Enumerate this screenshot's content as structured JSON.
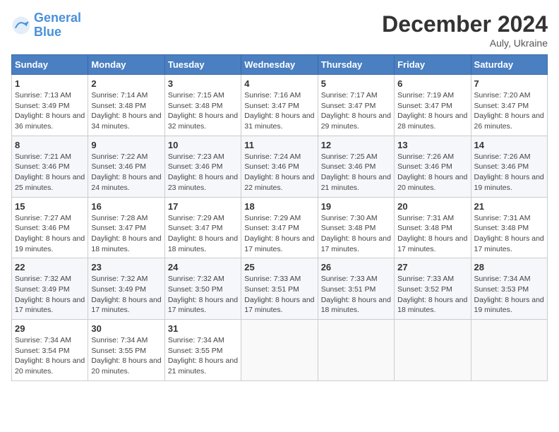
{
  "header": {
    "logo_general": "General",
    "logo_blue": "Blue",
    "month_year": "December 2024",
    "location": "Auly, Ukraine"
  },
  "days_of_week": [
    "Sunday",
    "Monday",
    "Tuesday",
    "Wednesday",
    "Thursday",
    "Friday",
    "Saturday"
  ],
  "weeks": [
    [
      {
        "day": "1",
        "sunrise": "7:13 AM",
        "sunset": "3:49 PM",
        "daylight": "8 hours and 36 minutes."
      },
      {
        "day": "2",
        "sunrise": "7:14 AM",
        "sunset": "3:48 PM",
        "daylight": "8 hours and 34 minutes."
      },
      {
        "day": "3",
        "sunrise": "7:15 AM",
        "sunset": "3:48 PM",
        "daylight": "8 hours and 32 minutes."
      },
      {
        "day": "4",
        "sunrise": "7:16 AM",
        "sunset": "3:47 PM",
        "daylight": "8 hours and 31 minutes."
      },
      {
        "day": "5",
        "sunrise": "7:17 AM",
        "sunset": "3:47 PM",
        "daylight": "8 hours and 29 minutes."
      },
      {
        "day": "6",
        "sunrise": "7:19 AM",
        "sunset": "3:47 PM",
        "daylight": "8 hours and 28 minutes."
      },
      {
        "day": "7",
        "sunrise": "7:20 AM",
        "sunset": "3:47 PM",
        "daylight": "8 hours and 26 minutes."
      }
    ],
    [
      {
        "day": "8",
        "sunrise": "7:21 AM",
        "sunset": "3:46 PM",
        "daylight": "8 hours and 25 minutes."
      },
      {
        "day": "9",
        "sunrise": "7:22 AM",
        "sunset": "3:46 PM",
        "daylight": "8 hours and 24 minutes."
      },
      {
        "day": "10",
        "sunrise": "7:23 AM",
        "sunset": "3:46 PM",
        "daylight": "8 hours and 23 minutes."
      },
      {
        "day": "11",
        "sunrise": "7:24 AM",
        "sunset": "3:46 PM",
        "daylight": "8 hours and 22 minutes."
      },
      {
        "day": "12",
        "sunrise": "7:25 AM",
        "sunset": "3:46 PM",
        "daylight": "8 hours and 21 minutes."
      },
      {
        "day": "13",
        "sunrise": "7:26 AM",
        "sunset": "3:46 PM",
        "daylight": "8 hours and 20 minutes."
      },
      {
        "day": "14",
        "sunrise": "7:26 AM",
        "sunset": "3:46 PM",
        "daylight": "8 hours and 19 minutes."
      }
    ],
    [
      {
        "day": "15",
        "sunrise": "7:27 AM",
        "sunset": "3:46 PM",
        "daylight": "8 hours and 19 minutes."
      },
      {
        "day": "16",
        "sunrise": "7:28 AM",
        "sunset": "3:47 PM",
        "daylight": "8 hours and 18 minutes."
      },
      {
        "day": "17",
        "sunrise": "7:29 AM",
        "sunset": "3:47 PM",
        "daylight": "8 hours and 18 minutes."
      },
      {
        "day": "18",
        "sunrise": "7:29 AM",
        "sunset": "3:47 PM",
        "daylight": "8 hours and 17 minutes."
      },
      {
        "day": "19",
        "sunrise": "7:30 AM",
        "sunset": "3:48 PM",
        "daylight": "8 hours and 17 minutes."
      },
      {
        "day": "20",
        "sunrise": "7:31 AM",
        "sunset": "3:48 PM",
        "daylight": "8 hours and 17 minutes."
      },
      {
        "day": "21",
        "sunrise": "7:31 AM",
        "sunset": "3:48 PM",
        "daylight": "8 hours and 17 minutes."
      }
    ],
    [
      {
        "day": "22",
        "sunrise": "7:32 AM",
        "sunset": "3:49 PM",
        "daylight": "8 hours and 17 minutes."
      },
      {
        "day": "23",
        "sunrise": "7:32 AM",
        "sunset": "3:49 PM",
        "daylight": "8 hours and 17 minutes."
      },
      {
        "day": "24",
        "sunrise": "7:32 AM",
        "sunset": "3:50 PM",
        "daylight": "8 hours and 17 minutes."
      },
      {
        "day": "25",
        "sunrise": "7:33 AM",
        "sunset": "3:51 PM",
        "daylight": "8 hours and 17 minutes."
      },
      {
        "day": "26",
        "sunrise": "7:33 AM",
        "sunset": "3:51 PM",
        "daylight": "8 hours and 18 minutes."
      },
      {
        "day": "27",
        "sunrise": "7:33 AM",
        "sunset": "3:52 PM",
        "daylight": "8 hours and 18 minutes."
      },
      {
        "day": "28",
        "sunrise": "7:34 AM",
        "sunset": "3:53 PM",
        "daylight": "8 hours and 19 minutes."
      }
    ],
    [
      {
        "day": "29",
        "sunrise": "7:34 AM",
        "sunset": "3:54 PM",
        "daylight": "8 hours and 20 minutes."
      },
      {
        "day": "30",
        "sunrise": "7:34 AM",
        "sunset": "3:55 PM",
        "daylight": "8 hours and 20 minutes."
      },
      {
        "day": "31",
        "sunrise": "7:34 AM",
        "sunset": "3:55 PM",
        "daylight": "8 hours and 21 minutes."
      },
      null,
      null,
      null,
      null
    ]
  ],
  "labels": {
    "sunrise": "Sunrise:",
    "sunset": "Sunset:",
    "daylight": "Daylight:"
  }
}
